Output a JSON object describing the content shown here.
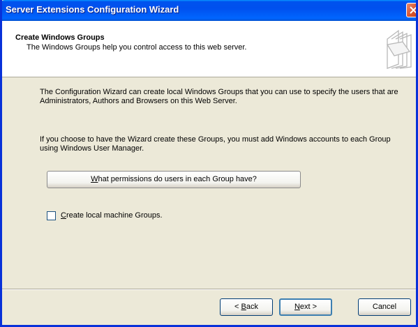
{
  "window": {
    "title": "Server Extensions Configuration Wizard"
  },
  "header": {
    "title": "Create Windows Groups",
    "subtitle": "The Windows Groups help you control access to this web server."
  },
  "body": {
    "paragraph1": "The Configuration Wizard can create local Windows Groups that you can use to specify the users that are Administrators, Authors and Browsers on this Web Server.",
    "paragraph2": "If you choose to have the Wizard create these Groups, you must add Windows accounts to each Group using Windows User Manager.",
    "permissions_button": {
      "accel": "W",
      "rest": "hat permissions do users in each Group have?"
    },
    "checkbox": {
      "accel": "C",
      "rest": "reate local machine Groups.",
      "checked": false
    }
  },
  "footer": {
    "back": {
      "prefix": "< ",
      "accel": "B",
      "rest": "ack"
    },
    "next": {
      "accel": "N",
      "rest": "ext >"
    },
    "cancel": "Cancel"
  }
}
